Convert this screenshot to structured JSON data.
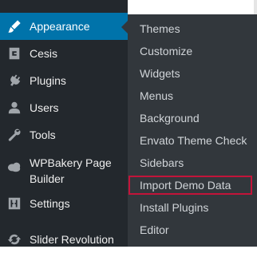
{
  "sidebar": {
    "items": [
      {
        "label": "Appearance",
        "icon": "paintbrush-icon"
      },
      {
        "label": "Cesis",
        "icon": "cesis-logo-icon"
      },
      {
        "label": "Plugins",
        "icon": "plug-icon"
      },
      {
        "label": "Users",
        "icon": "user-icon"
      },
      {
        "label": "Tools",
        "icon": "wrench-icon"
      },
      {
        "label": "WPBakery Page Builder",
        "icon": "cloud-icon"
      },
      {
        "label": "Settings",
        "icon": "settings-sliders-icon"
      },
      {
        "label": "Slider Revolution",
        "icon": "refresh-icon"
      }
    ]
  },
  "submenu": {
    "items": [
      {
        "label": "Themes"
      },
      {
        "label": "Customize"
      },
      {
        "label": "Widgets"
      },
      {
        "label": "Menus"
      },
      {
        "label": "Background"
      },
      {
        "label": "Envato Theme Check"
      },
      {
        "label": "Sidebars"
      },
      {
        "label": "Import Demo Data"
      },
      {
        "label": "Install Plugins"
      },
      {
        "label": "Editor"
      }
    ]
  },
  "colors": {
    "sidebar_bg": "#23282d",
    "submenu_bg": "#32373c",
    "active_bg": "#0073aa",
    "highlight_border": "#c2143a"
  }
}
